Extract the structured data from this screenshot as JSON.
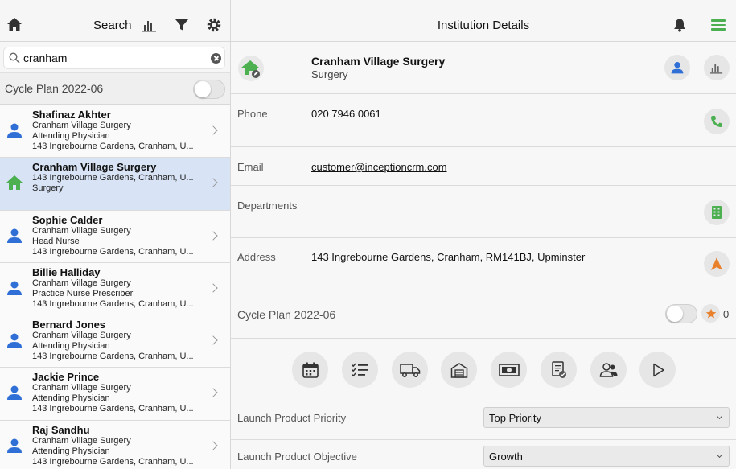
{
  "left": {
    "header_title": "Search",
    "search": {
      "value": "cranham",
      "placeholder": "Search"
    },
    "cycle_plan_label": "Cycle Plan 2022-06",
    "cycle_plan_on": false,
    "items": [
      {
        "type": "person",
        "name": "Shafinaz Akhter",
        "line1": "Cranham Village Surgery",
        "line2": "Attending Physician",
        "line3": "143 Ingrebourne Gardens,  Cranham, U..."
      },
      {
        "type": "institution",
        "name": "Cranham Village Surgery",
        "line1": "143 Ingrebourne Gardens,  Cranham, U...",
        "line2": "Surgery",
        "line3": ""
      },
      {
        "type": "person",
        "name": "Sophie Calder",
        "line1": "Cranham Village Surgery",
        "line2": "Head Nurse",
        "line3": "143 Ingrebourne Gardens,  Cranham, U..."
      },
      {
        "type": "person",
        "name": "Billie Halliday",
        "line1": "Cranham Village Surgery",
        "line2": "Practice Nurse Prescriber",
        "line3": "143 Ingrebourne Gardens,  Cranham, U..."
      },
      {
        "type": "person",
        "name": "Bernard Jones",
        "line1": "Cranham Village Surgery",
        "line2": "Attending Physician",
        "line3": "143 Ingrebourne Gardens,  Cranham, U..."
      },
      {
        "type": "person",
        "name": "Jackie Prince",
        "line1": "Cranham Village Surgery",
        "line2": "Attending Physician",
        "line3": "143 Ingrebourne Gardens,  Cranham, U..."
      },
      {
        "type": "person",
        "name": "Raj Sandhu",
        "line1": "Cranham Village Surgery",
        "line2": "Attending Physician",
        "line3": "143 Ingrebourne Gardens,  Cranham, U..."
      }
    ]
  },
  "right": {
    "header_title": "Institution Details",
    "institution": {
      "name": "Cranham Village Surgery",
      "type": "Surgery"
    },
    "phone": {
      "label": "Phone",
      "value": "020 7946 0061"
    },
    "email": {
      "label": "Email",
      "value": "customer@inceptioncrm.com"
    },
    "departments": {
      "label": "Departments"
    },
    "address": {
      "label": "Address",
      "value": "143 Ingrebourne Gardens,  Cranham, RM141BJ, Upminster"
    },
    "cycle_plan": {
      "label": "Cycle Plan 2022-06",
      "on": false,
      "star_count": "0"
    },
    "actions": [
      "calendar-icon",
      "checklist-icon",
      "truck-icon",
      "warehouse-icon",
      "money-icon",
      "document-check-icon",
      "people-icon",
      "play-icon"
    ],
    "launch_priority": {
      "label": "Launch Product Priority",
      "value": "Top Priority"
    },
    "launch_objective": {
      "label": "Launch Product Objective",
      "value": "Growth"
    }
  },
  "colors": {
    "accent_blue": "#2f6fd6",
    "green": "#4caf50",
    "orange": "#e8802c",
    "selected_row": "#d8e4f6"
  }
}
